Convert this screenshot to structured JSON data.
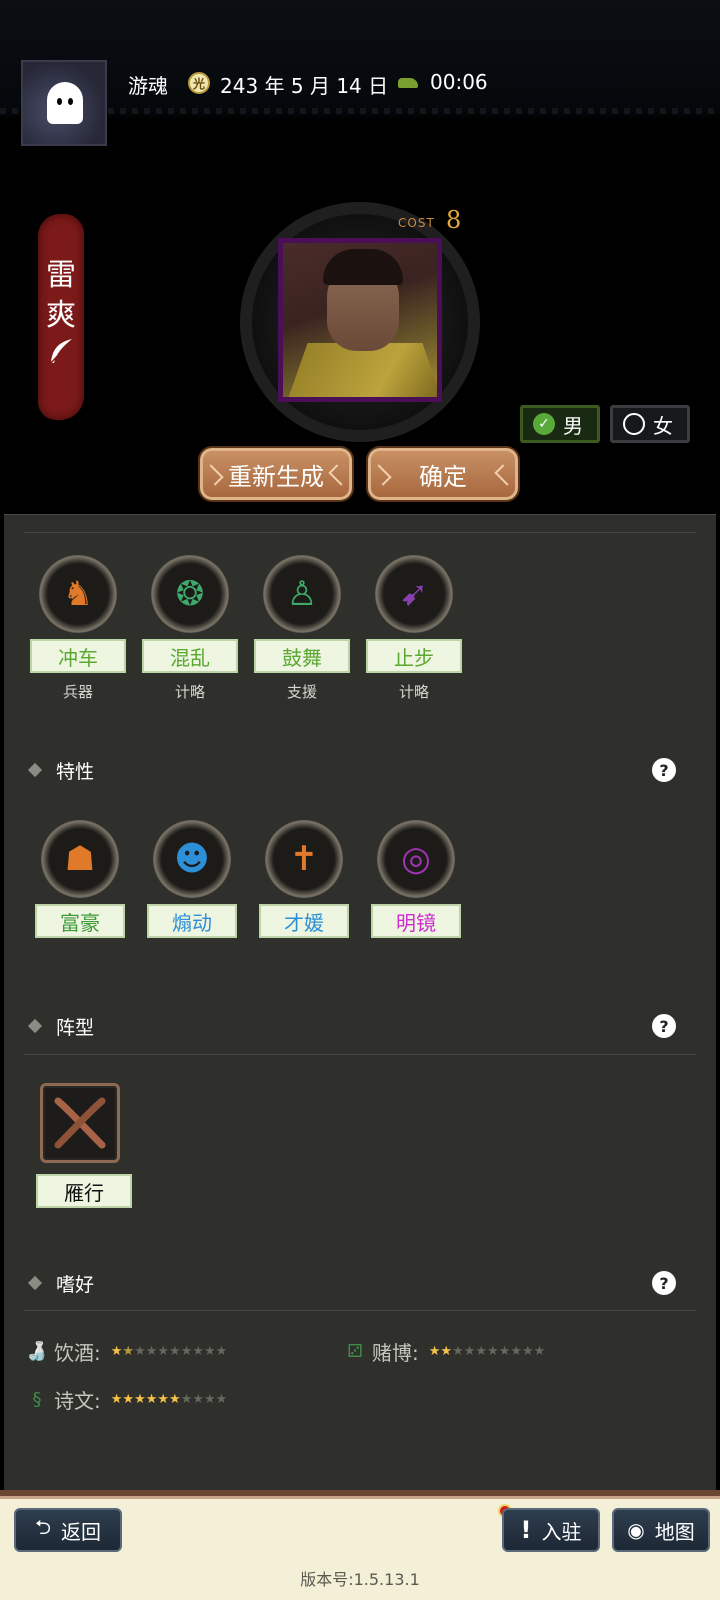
{
  "header": {
    "player_name": "游魂",
    "date": "243 年 5 月 14 日",
    "time": "00:06",
    "icons": {
      "avatar": "ghost-avatar-icon",
      "date": "calendar-icon",
      "time": "clock-icon"
    }
  },
  "character": {
    "name_chars": [
      "雷",
      "爽"
    ],
    "cost_label": "COST",
    "cost_value": "8",
    "gender_male": "男",
    "gender_female": "女",
    "selected_gender": "male"
  },
  "buttons": {
    "regenerate": "重新生成",
    "confirm": "确定"
  },
  "skills": [
    {
      "name": "冲车",
      "type": "兵器",
      "color": "#5aa832",
      "icon": "siege-horse-icon"
    },
    {
      "name": "混乱",
      "type": "计略",
      "color": "#5aa832",
      "icon": "swirl-icon"
    },
    {
      "name": "鼓舞",
      "type": "支援",
      "color": "#5aa832",
      "icon": "person-wings-icon"
    },
    {
      "name": "止步",
      "type": "计略",
      "color": "#5aa832",
      "icon": "boot-icon"
    }
  ],
  "traits_section": {
    "title": "特性",
    "help": "?"
  },
  "traits": [
    {
      "name": "富豪",
      "color": "#3f9a3a",
      "icon": "rich-man-icon"
    },
    {
      "name": "煽动",
      "color": "#2c8fd8",
      "icon": "agitator-icon"
    },
    {
      "name": "才媛",
      "color": "#2c8fd8",
      "icon": "cross-figure-icon"
    },
    {
      "name": "明镜",
      "color": "#d02ad4",
      "icon": "mirror-icon"
    }
  ],
  "formation_section": {
    "title": "阵型",
    "help": "?"
  },
  "formation": {
    "name": "雁行",
    "icon": "crossed-feathers-icon"
  },
  "hobby_section": {
    "title": "嗜好",
    "help": "?"
  },
  "hobbies": [
    {
      "label": "饮酒:",
      "stars": 1.5,
      "max": 10,
      "icon": "wine-bottle-icon"
    },
    {
      "label": "赌博:",
      "stars": 2,
      "max": 10,
      "icon": "dice-icon"
    },
    {
      "label": "诗文:",
      "stars": 6,
      "max": 10,
      "icon": "scroll-icon"
    }
  ],
  "bottom_nav": {
    "back": "返回",
    "enter": "入驻",
    "map": "地图",
    "version": "版本号:1.5.13.1"
  }
}
